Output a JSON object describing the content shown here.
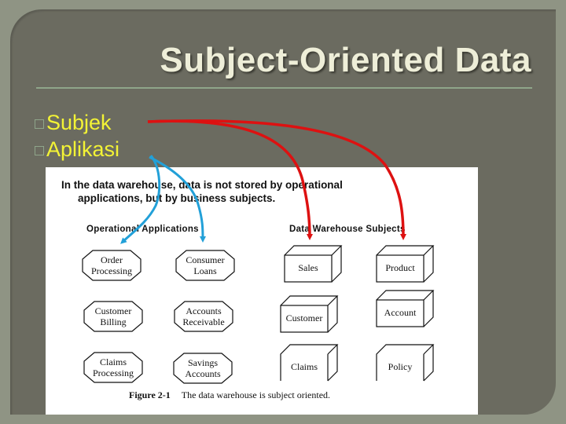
{
  "slide": {
    "title": "Subject-Oriented Data",
    "bullets": [
      {
        "label": "Subjek",
        "arrow_color": "#dd1111"
      },
      {
        "label": "Aplikasi",
        "arrow_color": "#22a0d8"
      }
    ],
    "colors": {
      "frame": "#8f9484",
      "panel": "#6b6b60",
      "title": "#eeeed8",
      "bullet_text": "#f3f335",
      "rule": "#8fa58a"
    }
  },
  "figure": {
    "intro_line1": "In the data warehouse, data is not stored by operational",
    "intro_line2": "applications, but by business subjects.",
    "operational_heading": "Operational Applications",
    "warehouse_heading": "Data Warehouse Subjects",
    "applications": [
      {
        "line1": "Order",
        "line2": "Processing"
      },
      {
        "line1": "Consumer",
        "line2": "Loans"
      },
      {
        "line1": "Customer",
        "line2": "Billing"
      },
      {
        "line1": "Accounts",
        "line2": "Receivable"
      },
      {
        "line1": "Claims",
        "line2": "Processing"
      },
      {
        "line1": "Savings",
        "line2": "Accounts"
      }
    ],
    "subjects": [
      "Sales",
      "Product",
      "Customer",
      "Account",
      "Claims",
      "Policy"
    ],
    "caption_label": "Figure 2-1",
    "caption_text": "The data warehouse is subject oriented."
  }
}
